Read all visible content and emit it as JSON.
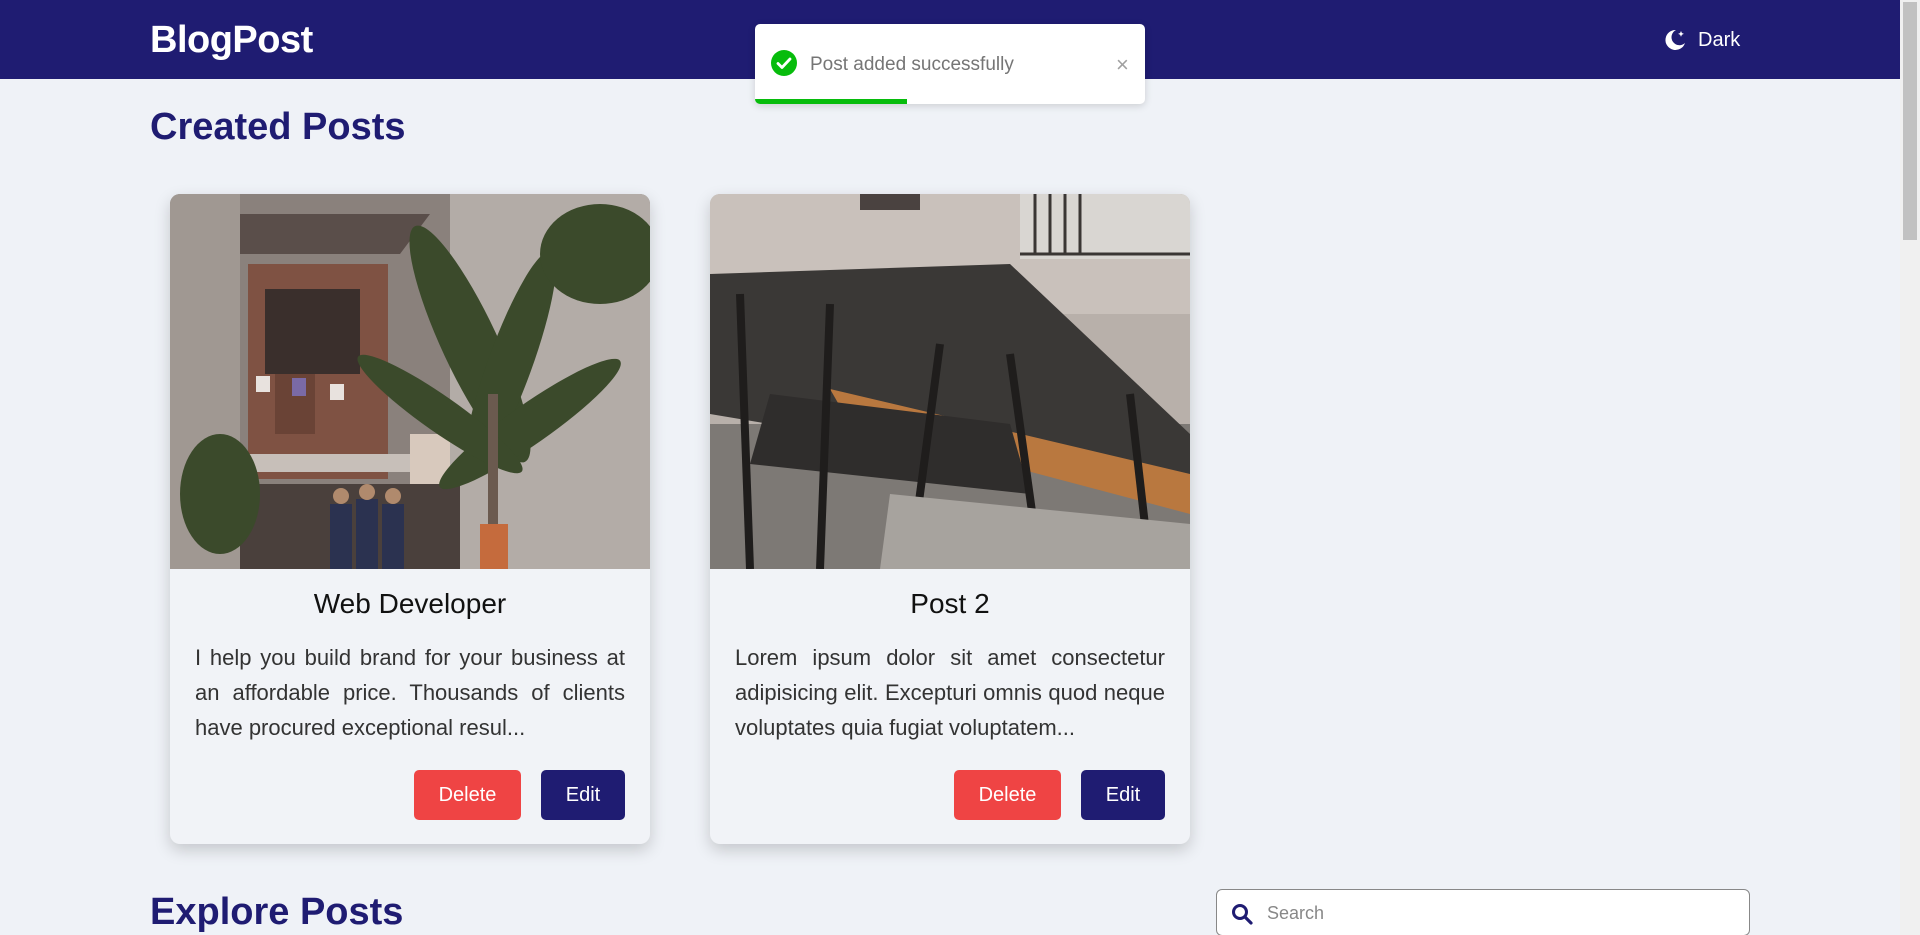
{
  "navbar": {
    "brand": "BlogPost",
    "theme_toggle": {
      "label": "Dark",
      "icon": "moon-icon"
    }
  },
  "toast": {
    "message": "Post added successfully",
    "close_glyph": "×",
    "icon": "check-circle-icon",
    "progress": 0.39,
    "progress_color": "#07bc0c"
  },
  "created_section": {
    "title": "Created Posts"
  },
  "posts": [
    {
      "title": "Web Developer",
      "body": "I help you build brand for your business at an affordable price. Thousands of clients have procured exceptional resul...",
      "image": "building-courtyard-photo",
      "delete_label": "Delete",
      "edit_label": "Edit"
    },
    {
      "title": "Post 2",
      "body": "Lorem ipsum dolor sit amet consectetur adipisicing elit. Excepturi omnis quod neque voluptates quia fugiat voluptatem...",
      "image": "classroom-benches-photo",
      "delete_label": "Delete",
      "edit_label": "Edit"
    }
  ],
  "explore_section": {
    "title": "Explore Posts"
  },
  "search": {
    "placeholder": "Search",
    "value": "",
    "icon": "search-icon"
  },
  "colors": {
    "primary": "#1f1c72",
    "danger": "#ef4444",
    "background": "#eff2f7",
    "success": "#07bc0c"
  }
}
